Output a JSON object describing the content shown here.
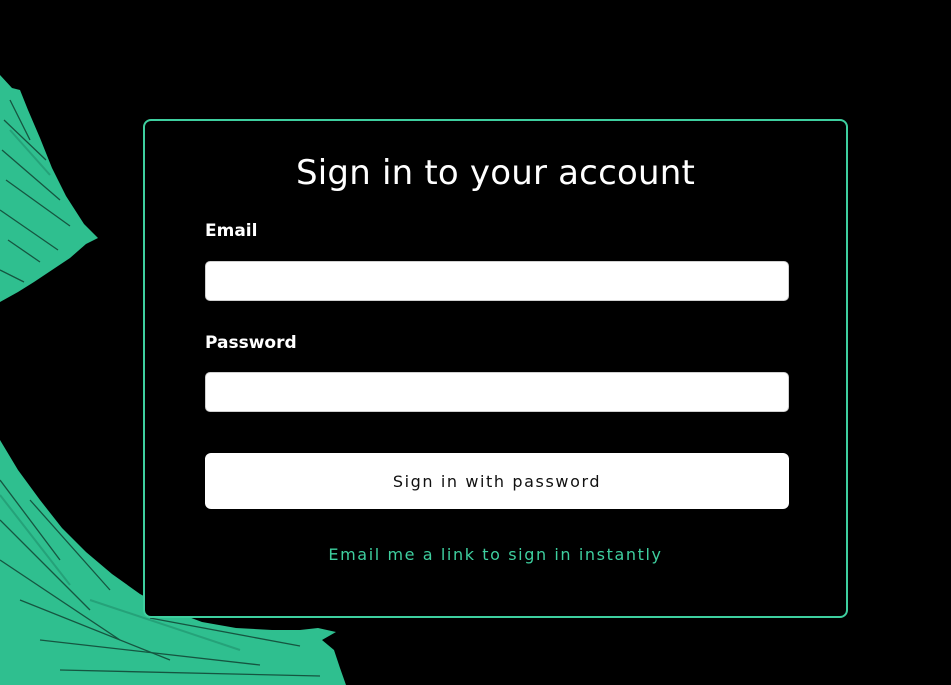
{
  "colors": {
    "background": "#000000",
    "accent": "#3ecf9f",
    "brush": "#2fbf8f",
    "text": "#ffffff"
  },
  "card": {
    "title": "Sign in to your account"
  },
  "form": {
    "email_label": "Email",
    "email_value": "",
    "password_label": "Password",
    "password_value": "",
    "submit_label": "Sign in with password",
    "magic_link_label": "Email me a link to sign in instantly"
  }
}
